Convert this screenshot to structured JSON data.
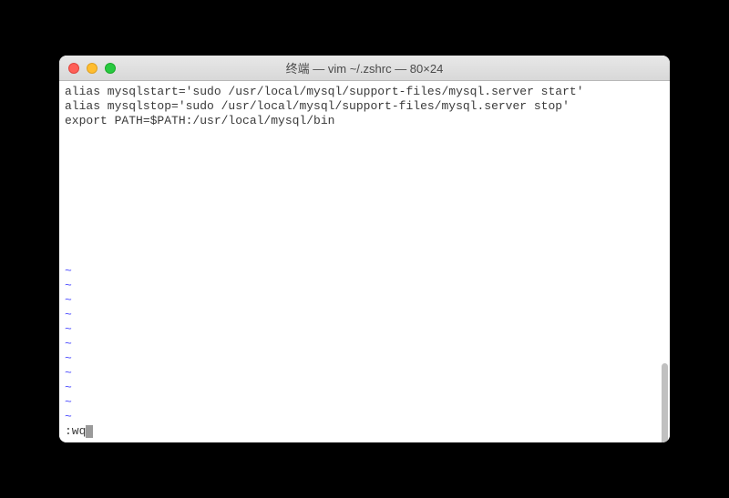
{
  "window": {
    "title": "终端 — vim ~/.zshrc — 80×24"
  },
  "editor": {
    "lines": [
      "alias mysqlstart='sudo /usr/local/mysql/support-files/mysql.server start'",
      "alias mysqlstop='sudo /usr/local/mysql/support-files/mysql.server stop'",
      "export PATH=$PATH:/usr/local/mysql/bin"
    ],
    "tilde_count": 11,
    "tilde_char": "~",
    "command": ":wq"
  }
}
